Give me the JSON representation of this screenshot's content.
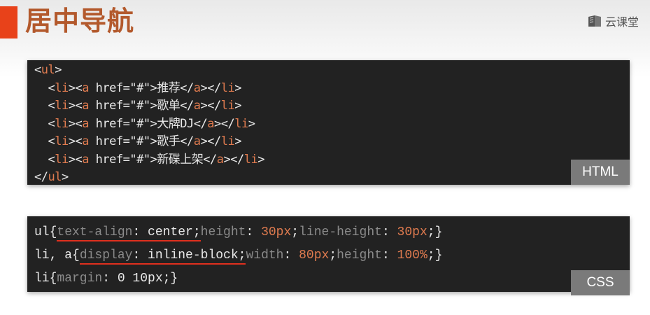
{
  "header": {
    "title": "居中导航",
    "brand": "云课堂",
    "brand_icon": "book-icon",
    "accent_color": "#e8421a",
    "title_color": "#b3592c"
  },
  "html_panel": {
    "badge": "HTML",
    "lines": [
      {
        "tokens": [
          {
            "t": "<",
            "c": "plain"
          },
          {
            "t": "ul",
            "c": "tag"
          },
          {
            "t": ">",
            "c": "plain"
          }
        ]
      },
      {
        "tokens": [
          {
            "t": "  <",
            "c": "plain"
          },
          {
            "t": "li",
            "c": "tag"
          },
          {
            "t": "><",
            "c": "plain"
          },
          {
            "t": "a",
            "c": "tag"
          },
          {
            "t": " href=\"#\">推荐</",
            "c": "plain"
          },
          {
            "t": "a",
            "c": "tag"
          },
          {
            "t": "></",
            "c": "plain"
          },
          {
            "t": "li",
            "c": "tag"
          },
          {
            "t": ">",
            "c": "plain"
          }
        ]
      },
      {
        "tokens": [
          {
            "t": "  <",
            "c": "plain"
          },
          {
            "t": "li",
            "c": "tag"
          },
          {
            "t": "><",
            "c": "plain"
          },
          {
            "t": "a",
            "c": "tag"
          },
          {
            "t": " href=\"#\">歌单</",
            "c": "plain"
          },
          {
            "t": "a",
            "c": "tag"
          },
          {
            "t": "></",
            "c": "plain"
          },
          {
            "t": "li",
            "c": "tag"
          },
          {
            "t": ">",
            "c": "plain"
          }
        ]
      },
      {
        "tokens": [
          {
            "t": "  <",
            "c": "plain"
          },
          {
            "t": "li",
            "c": "tag"
          },
          {
            "t": "><",
            "c": "plain"
          },
          {
            "t": "a",
            "c": "tag"
          },
          {
            "t": " href=\"#\">大牌DJ</",
            "c": "plain"
          },
          {
            "t": "a",
            "c": "tag"
          },
          {
            "t": "></",
            "c": "plain"
          },
          {
            "t": "li",
            "c": "tag"
          },
          {
            "t": ">",
            "c": "plain"
          }
        ]
      },
      {
        "tokens": [
          {
            "t": "  <",
            "c": "plain"
          },
          {
            "t": "li",
            "c": "tag"
          },
          {
            "t": "><",
            "c": "plain"
          },
          {
            "t": "a",
            "c": "tag"
          },
          {
            "t": " href=\"#\">歌手</",
            "c": "plain"
          },
          {
            "t": "a",
            "c": "tag"
          },
          {
            "t": "></",
            "c": "plain"
          },
          {
            "t": "li",
            "c": "tag"
          },
          {
            "t": ">",
            "c": "plain"
          }
        ]
      },
      {
        "tokens": [
          {
            "t": "  <",
            "c": "plain"
          },
          {
            "t": "li",
            "c": "tag"
          },
          {
            "t": "><",
            "c": "plain"
          },
          {
            "t": "a",
            "c": "tag"
          },
          {
            "t": " href=\"#\">新碟上架</",
            "c": "plain"
          },
          {
            "t": "a",
            "c": "tag"
          },
          {
            "t": "></",
            "c": "plain"
          },
          {
            "t": "li",
            "c": "tag"
          },
          {
            "t": ">",
            "c": "plain"
          }
        ]
      },
      {
        "tokens": [
          {
            "t": "</",
            "c": "plain"
          },
          {
            "t": "ul",
            "c": "tag"
          },
          {
            "t": ">",
            "c": "plain"
          }
        ]
      }
    ]
  },
  "css_panel": {
    "badge": "CSS",
    "underline_color": "#e0301e",
    "lines": [
      {
        "tokens": [
          {
            "t": "ul{",
            "c": "plain"
          },
          {
            "t": "text-align",
            "c": "prop",
            "u": true
          },
          {
            "t": ": center;",
            "c": "plain",
            "u": true
          },
          {
            "t": "height",
            "c": "prop"
          },
          {
            "t": ": ",
            "c": "plain"
          },
          {
            "t": "30px",
            "c": "num"
          },
          {
            "t": ";",
            "c": "plain"
          },
          {
            "t": "line-height",
            "c": "prop"
          },
          {
            "t": ": ",
            "c": "plain"
          },
          {
            "t": "30px",
            "c": "num"
          },
          {
            "t": ";}",
            "c": "plain"
          }
        ]
      },
      {
        "tokens": [
          {
            "t": "li, a{",
            "c": "plain"
          },
          {
            "t": "display",
            "c": "prop",
            "u": true
          },
          {
            "t": ": inline-block;",
            "c": "plain",
            "u": true
          },
          {
            "t": "width",
            "c": "prop"
          },
          {
            "t": ": ",
            "c": "plain"
          },
          {
            "t": "80px",
            "c": "num"
          },
          {
            "t": ";",
            "c": "plain"
          },
          {
            "t": "height",
            "c": "prop"
          },
          {
            "t": ": ",
            "c": "plain"
          },
          {
            "t": "100%",
            "c": "num"
          },
          {
            "t": ";}",
            "c": "plain"
          }
        ]
      },
      {
        "tokens": [
          {
            "t": "li{",
            "c": "plain"
          },
          {
            "t": "margin",
            "c": "prop"
          },
          {
            "t": ": 0 10px;}",
            "c": "plain"
          }
        ]
      }
    ]
  }
}
